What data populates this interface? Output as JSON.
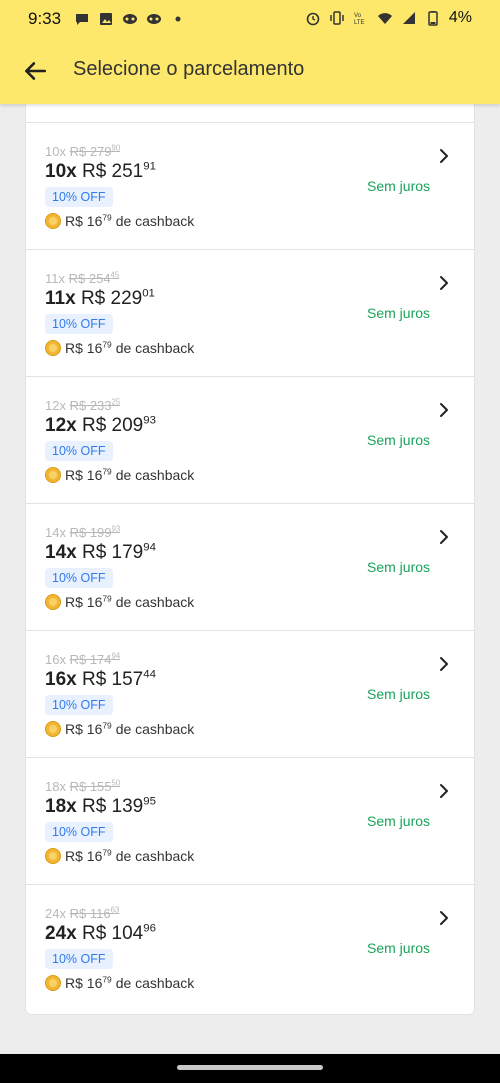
{
  "status": {
    "time": "9:33",
    "battery": "4%"
  },
  "header": {
    "title": "Selecione o parcelamento"
  },
  "options": [
    {
      "orig_n": "10x",
      "orig_reais": "R$ 279",
      "orig_cents": "90",
      "n": "10x",
      "reais": "R$ 251",
      "cents": "91",
      "badge": "10% OFF",
      "cb_reais": "R$ 16",
      "cb_cents": "79",
      "cb_suffix": "de cashback",
      "tag": "Sem juros"
    },
    {
      "orig_n": "11x",
      "orig_reais": "R$ 254",
      "orig_cents": "45",
      "n": "11x",
      "reais": "R$ 229",
      "cents": "01",
      "badge": "10% OFF",
      "cb_reais": "R$ 16",
      "cb_cents": "79",
      "cb_suffix": "de cashback",
      "tag": "Sem juros"
    },
    {
      "orig_n": "12x",
      "orig_reais": "R$ 233",
      "orig_cents": "25",
      "n": "12x",
      "reais": "R$ 209",
      "cents": "93",
      "badge": "10% OFF",
      "cb_reais": "R$ 16",
      "cb_cents": "79",
      "cb_suffix": "de cashback",
      "tag": "Sem juros"
    },
    {
      "orig_n": "14x",
      "orig_reais": "R$ 199",
      "orig_cents": "93",
      "n": "14x",
      "reais": "R$ 179",
      "cents": "94",
      "badge": "10% OFF",
      "cb_reais": "R$ 16",
      "cb_cents": "79",
      "cb_suffix": "de cashback",
      "tag": "Sem juros"
    },
    {
      "orig_n": "16x",
      "orig_reais": "R$ 174",
      "orig_cents": "94",
      "n": "16x",
      "reais": "R$ 157",
      "cents": "44",
      "badge": "10% OFF",
      "cb_reais": "R$ 16",
      "cb_cents": "79",
      "cb_suffix": "de cashback",
      "tag": "Sem juros"
    },
    {
      "orig_n": "18x",
      "orig_reais": "R$ 155",
      "orig_cents": "50",
      "n": "18x",
      "reais": "R$ 139",
      "cents": "95",
      "badge": "10% OFF",
      "cb_reais": "R$ 16",
      "cb_cents": "79",
      "cb_suffix": "de cashback",
      "tag": "Sem juros"
    },
    {
      "orig_n": "24x",
      "orig_reais": "R$ 116",
      "orig_cents": "63",
      "n": "24x",
      "reais": "R$ 104",
      "cents": "96",
      "badge": "10% OFF",
      "cb_reais": "R$ 16",
      "cb_cents": "79",
      "cb_suffix": "de cashback",
      "tag": "Sem juros"
    }
  ],
  "colors": {
    "header_bg": "#fde86b",
    "accent_green": "#1aa35a",
    "badge_blue": "#2f7bf0"
  }
}
